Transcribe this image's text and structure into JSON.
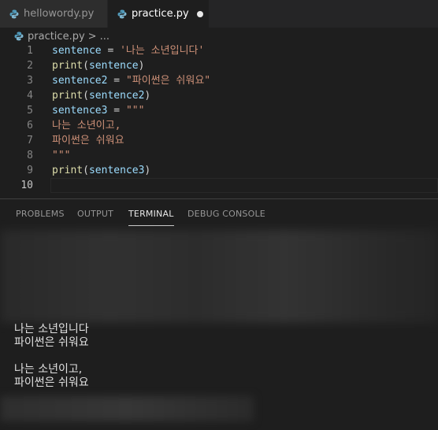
{
  "tabs": [
    {
      "label": "hellowordy.py",
      "active": false,
      "dirty": false
    },
    {
      "label": "practice.py",
      "active": true,
      "dirty": true
    }
  ],
  "breadcrumb": {
    "file": "practice.py",
    "separator": ">",
    "trail": "..."
  },
  "editor": {
    "lines": [
      {
        "n": "1",
        "tokens": [
          {
            "t": "sentence",
            "c": "v"
          },
          {
            "t": " = ",
            "c": "p"
          },
          {
            "t": "'나는 소년입니다'",
            "c": "s"
          }
        ]
      },
      {
        "n": "2",
        "tokens": [
          {
            "t": "print",
            "c": "f"
          },
          {
            "t": "(",
            "c": "p"
          },
          {
            "t": "sentence",
            "c": "v"
          },
          {
            "t": ")",
            "c": "p"
          }
        ]
      },
      {
        "n": "3",
        "tokens": [
          {
            "t": "sentence2",
            "c": "v"
          },
          {
            "t": " = ",
            "c": "p"
          },
          {
            "t": "\"파이썬은 쉬워요\"",
            "c": "s"
          }
        ]
      },
      {
        "n": "4",
        "tokens": [
          {
            "t": "print",
            "c": "f"
          },
          {
            "t": "(",
            "c": "p"
          },
          {
            "t": "sentence2",
            "c": "v"
          },
          {
            "t": ")",
            "c": "p"
          }
        ]
      },
      {
        "n": "5",
        "tokens": [
          {
            "t": "sentence3",
            "c": "v"
          },
          {
            "t": " = ",
            "c": "p"
          },
          {
            "t": "\"\"\"",
            "c": "s"
          }
        ]
      },
      {
        "n": "6",
        "tokens": [
          {
            "t": "나는 소년이고,",
            "c": "s"
          }
        ]
      },
      {
        "n": "7",
        "tokens": [
          {
            "t": "파이썬은 쉬워요",
            "c": "s"
          }
        ]
      },
      {
        "n": "8",
        "tokens": [
          {
            "t": "\"\"\"",
            "c": "s"
          }
        ]
      },
      {
        "n": "9",
        "tokens": [
          {
            "t": "print",
            "c": "f"
          },
          {
            "t": "(",
            "c": "p"
          },
          {
            "t": "sentence3",
            "c": "v"
          },
          {
            "t": ")",
            "c": "p"
          }
        ]
      },
      {
        "n": "10",
        "tokens": []
      }
    ],
    "current_line": "10"
  },
  "panel": {
    "tabs": [
      "PROBLEMS",
      "OUTPUT",
      "TERMINAL",
      "DEBUG CONSOLE"
    ],
    "active_tab": "TERMINAL"
  },
  "terminal": {
    "output": [
      "나는 소년입니다",
      "파이썬은 쉬워요",
      "",
      "나는 소년이고,",
      "파이썬은 쉬워요"
    ]
  },
  "colors": {
    "variable": "#9cdcfe",
    "function": "#dcdcaa",
    "string": "#ce9178",
    "python_icon": "#519aba"
  }
}
